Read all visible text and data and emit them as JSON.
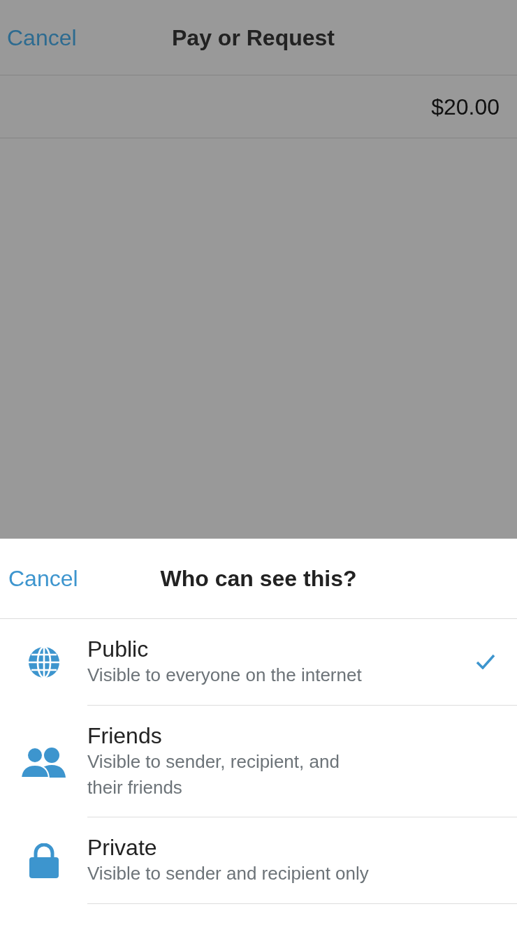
{
  "background_screen": {
    "cancel": "Cancel",
    "title": "Pay or Request",
    "amount": "$20.00"
  },
  "sheet": {
    "cancel": "Cancel",
    "title": "Who can see this?",
    "options": [
      {
        "kind": "globe",
        "label": "Public",
        "description": "Visible to everyone on the internet",
        "selected": true
      },
      {
        "kind": "people",
        "label": "Friends",
        "description": "Visible to sender, recipient, and their friends",
        "selected": false
      },
      {
        "kind": "lock",
        "label": "Private",
        "description": "Visible to sender and recipient only",
        "selected": false
      }
    ]
  }
}
